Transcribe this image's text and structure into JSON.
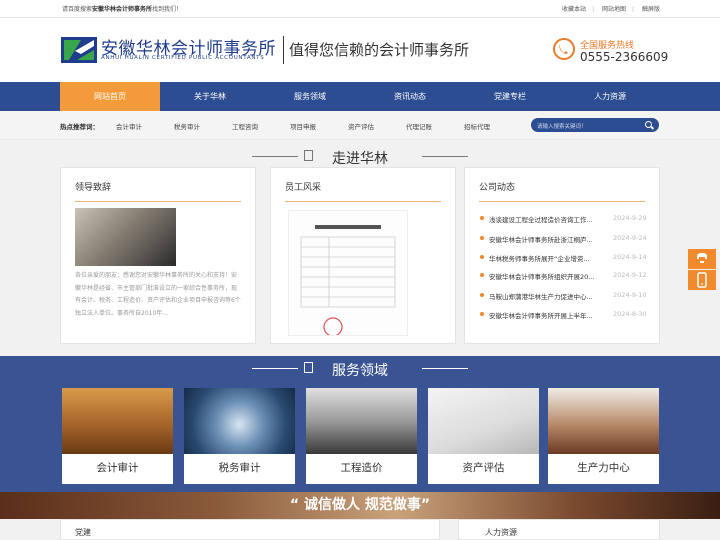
{
  "topbar": {
    "tip_before": "请百度搜索",
    "tip_bold": "安徽华林会计师事务所",
    "tip_after": "找到我们！",
    "links": [
      "收藏本站",
      "网站地图",
      "触屏版"
    ]
  },
  "header": {
    "logo_cn": "安徽华林会计师事务所",
    "logo_en": "ANHUI HUALIN CERTIFIED PUBLIC ACCOUNTANTS",
    "slogan": "值得您信赖的会计师事务所",
    "hotline_label": "全国服务热线",
    "hotline_number": "0555-2366609"
  },
  "nav": [
    "网站首页",
    "关于华林",
    "服务领域",
    "资讯动态",
    "党建专栏",
    "人力资源"
  ],
  "hot": {
    "label": "热点推荐词：",
    "items": [
      "会计审计",
      "税务审计",
      "工程咨询",
      "项目申报",
      "资产评估",
      "代理记账",
      "招标代理"
    ],
    "search_placeholder": "请输入搜索关键词！"
  },
  "section_about": {
    "title": "走进华林",
    "leader": {
      "title": "领导致辞",
      "text": "各位亲爱的朋友：感谢您对安徽华林事务所的关心和支持！安徽华林是经省、市主管部门批准设立的一家综合性事务所，现有会计、税务、工程造价、资产评估和企业项目申报咨询等6个独立法人单位。事务所自2010年..."
    },
    "staff": {
      "title": "员工风采"
    },
    "news": {
      "title": "公司动态",
      "items": [
        {
          "title": "浅谈建设工程全过程造价咨询工作...",
          "date": "2024-9-29"
        },
        {
          "title": "安徽华林会计师事务所赴浙江桐庐...",
          "date": "2024-9-24"
        },
        {
          "title": "华林税务师事务所展开“企业增资...",
          "date": "2024-9-14"
        },
        {
          "title": "安徽华林会计师事务所组织开展20...",
          "date": "2024-9-12"
        },
        {
          "title": "马鞍山郑蒲港华林生产力促进中心...",
          "date": "2024-9-10"
        },
        {
          "title": "安徽华林会计师事务所开展上半年...",
          "date": "2024-8-30"
        }
      ]
    }
  },
  "section_services": {
    "title": "服务领域",
    "items": [
      "会计审计",
      "税务审计",
      "工程造价",
      "资产评估",
      "生产力中心"
    ]
  },
  "banner": {
    "text": "“ 诚信做人 规范做事”"
  },
  "bottom": {
    "left_title": "党建",
    "right_title": "人力资源"
  },
  "colors": {
    "brand_blue": "#2d4d92",
    "accent_orange": "#f39a3a"
  }
}
